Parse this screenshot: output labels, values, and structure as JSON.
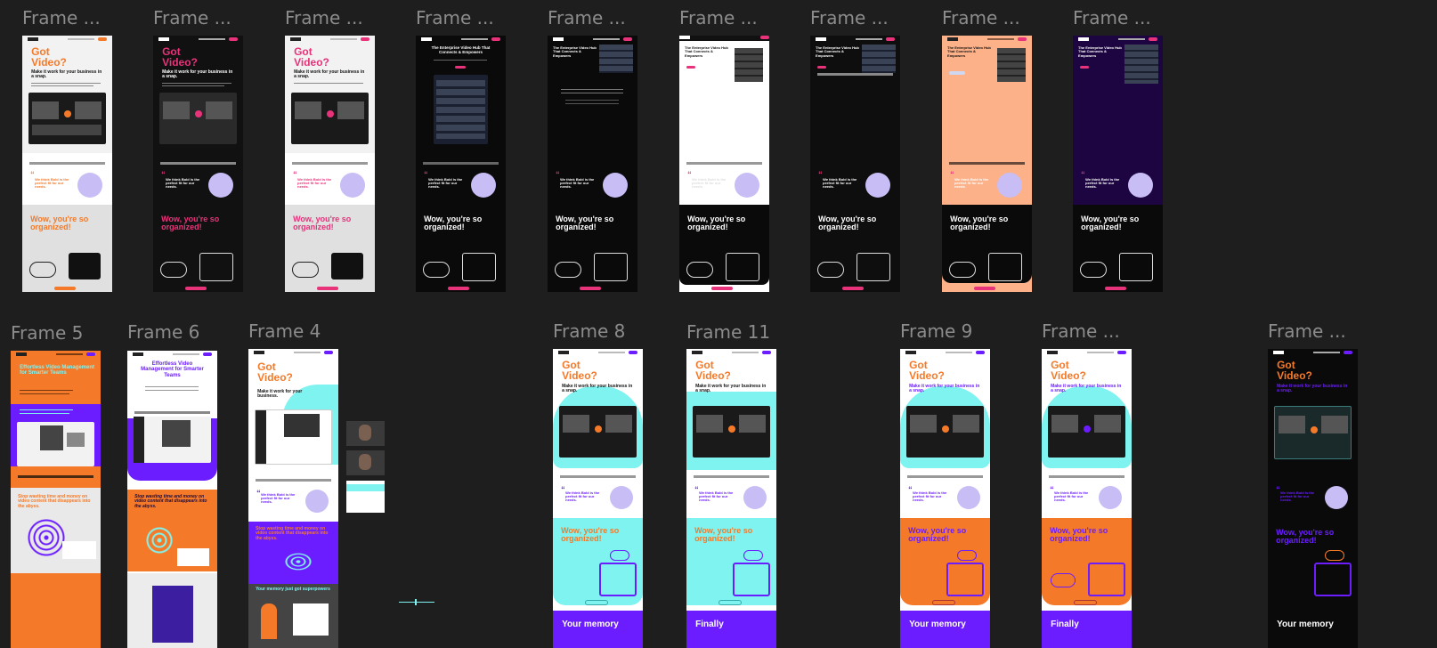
{
  "canvas": {
    "background": "#1e1e1e",
    "label_color": "#8c8c8c"
  },
  "top_row": {
    "frames": [
      {
        "label": "Frame ...",
        "theme": "light-orange",
        "headline": "Got Video?",
        "sub": "Make it work for your business in a snap.",
        "quote_text": "We think Bold is the perfect fit for our needs.",
        "big_text": "Wow, you're so organized!"
      },
      {
        "label": "Frame ...",
        "theme": "dark-pink",
        "headline": "Got Video?",
        "sub": "Make it work for your business in a snap.",
        "quote_text": "We think Bold is the perfect fit for our needs.",
        "big_text": "Wow, you're so organized!"
      },
      {
        "label": "Frame ...",
        "theme": "light-pink",
        "headline": "Got Video?",
        "sub": "Make it work for your business in a snap.",
        "quote_text": "We think Bold is the perfect fit for our needs.",
        "big_text": "Wow, you're so organized!"
      },
      {
        "label": "Frame ...",
        "theme": "dark-enterprise",
        "headline": "The Enterprise Video Hub That Connects & Empowers",
        "sub": "",
        "quote_text": "We think Bold is the perfect fit for our needs.",
        "big_text": "Wow, you're so organized!"
      },
      {
        "label": "Frame ...",
        "theme": "dark-enterprise-2",
        "headline": "The Enterprise Video Hub That Connects & Empowers",
        "sub": "",
        "quote_text": "We think Bold is the perfect fit for our needs.",
        "big_text": "Wow, you're so organized!"
      },
      {
        "label": "Frame ...",
        "theme": "white-enterprise",
        "headline": "The Enterprise Video Hub That Connects & Empowers",
        "sub": "",
        "quote_text": "We think Bold is the perfect fit for our needs.",
        "big_text": "Wow, you're so organized!"
      },
      {
        "label": "Frame ...",
        "theme": "black-enterprise",
        "headline": "The Enterprise Video Hub That Connects & Empowers",
        "sub": "",
        "quote_text": "We think Bold is the perfect fit for our needs.",
        "big_text": "Wow, you're so organized!"
      },
      {
        "label": "Frame ...",
        "theme": "peach-enterprise",
        "headline": "The Enterprise Video Hub That Connects & Empowers",
        "sub": "",
        "quote_text": "We think Bold is the perfect fit for our needs.",
        "big_text": "Wow, you're so organized!"
      },
      {
        "label": "Frame ...",
        "theme": "purple-enterprise",
        "headline": "The Enterprise Video Hub That Connects & Empowers",
        "sub": "",
        "quote_text": "We think Bold is the perfect fit for our needs.",
        "big_text": "Wow, you're so organized!"
      }
    ]
  },
  "bottom_row": {
    "frames": [
      {
        "label": "Frame 5",
        "theme": "orange-effortless",
        "headline": "Effortless Video Management for Smarter Teams",
        "sub": "",
        "big_text": "Stop wasting time and money on video content that disappears into the abyss."
      },
      {
        "label": "Frame 6",
        "theme": "white-effortless",
        "headline": "Effortless Video Management for Smarter Teams",
        "sub": "",
        "big_text": "Stop wasting time and money on video content that disappears into the abyss."
      },
      {
        "label": "Frame 4",
        "theme": "cyan-got-video",
        "headline": "Got Video?",
        "sub": "Make it work for your business.",
        "quote_text": "We think Bold is the perfect fit for our needs.",
        "big_text": "Stop wasting time and money on video content that disappears into the abyss.",
        "memory_text": "Your memory just got superpowers"
      },
      {
        "label": "Frame 8",
        "theme": "cyan-pill",
        "headline": "Got Video?",
        "sub": "Make it work for your business in a snap.",
        "quote_text": "We think Bold is the perfect fit for our needs.",
        "big_text": "Wow, you're so organized!",
        "footer_text": "Your memory"
      },
      {
        "label": "Frame 11",
        "theme": "cyan-block",
        "headline": "Got Video?",
        "sub": "Make it work for your business in a snap.",
        "quote_text": "We think Bold is the perfect fit for our needs.",
        "big_text": "Wow, you're so organized!",
        "footer_text": "Finally"
      },
      {
        "label": "Frame 9",
        "theme": "orange-cyan",
        "headline": "Got Video?",
        "sub": "Make it work for your business in a snap.",
        "quote_text": "We think Bold is the perfect fit for our needs.",
        "big_text": "Wow, you're so organized!",
        "footer_text": "Your memory"
      },
      {
        "label": "Frame ...",
        "theme": "orange-purple",
        "headline": "Got Video?",
        "sub": "Make it work for your business in a snap.",
        "quote_text": "We think Bold is the perfect fit for our needs.",
        "big_text": "Wow, you're so organized!",
        "footer_text": "Finally"
      },
      {
        "label": "Frame ...",
        "theme": "dark-purple-orange",
        "headline": "Got Video?",
        "sub": "Make it work for your business in a snap.",
        "quote_text": "We think Bold is the perfect fit for our needs.",
        "big_text": "Wow, you're so organized!",
        "footer_text": "Your memory"
      }
    ]
  },
  "colors": {
    "orange": "#f47a2a",
    "pink": "#e8327a",
    "purple": "#6b1dff",
    "cyan": "#7ff3f0",
    "peach": "#fcb189",
    "dark": "#0c0c0c",
    "deep_purple": "#1c0541",
    "light_grey": "#f2f2f2",
    "mid_grey": "#d9d9d9"
  }
}
